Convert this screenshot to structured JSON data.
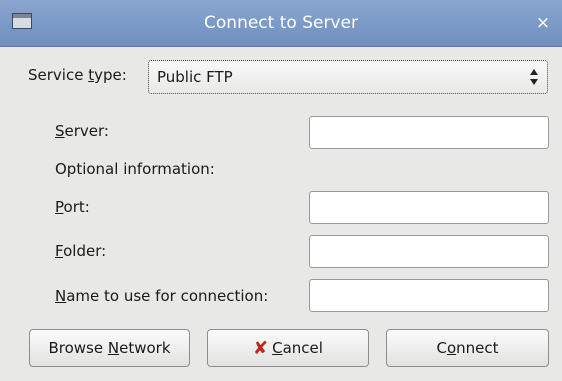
{
  "window": {
    "title": "Connect to Server",
    "close_glyph": "×"
  },
  "service": {
    "label_pre": "Service ",
    "label_key": "t",
    "label_post": "ype:",
    "selected": "Public FTP"
  },
  "server": {
    "key": "S",
    "rest": "erver:",
    "value": ""
  },
  "optional": {
    "label": "Optional information:"
  },
  "port": {
    "key": "P",
    "rest": "ort:",
    "value": ""
  },
  "folder": {
    "key": "F",
    "rest": "older:",
    "value": ""
  },
  "connname": {
    "key": "N",
    "rest": "ame to use for connection:",
    "value": ""
  },
  "buttons": {
    "browse": {
      "pre": "Browse ",
      "key": "N",
      "post": "etwork"
    },
    "cancel": {
      "icon": "✘",
      "key": "C",
      "post": "ancel"
    },
    "connect": {
      "pre": "C",
      "key": "o",
      "post": "nnect"
    }
  }
}
